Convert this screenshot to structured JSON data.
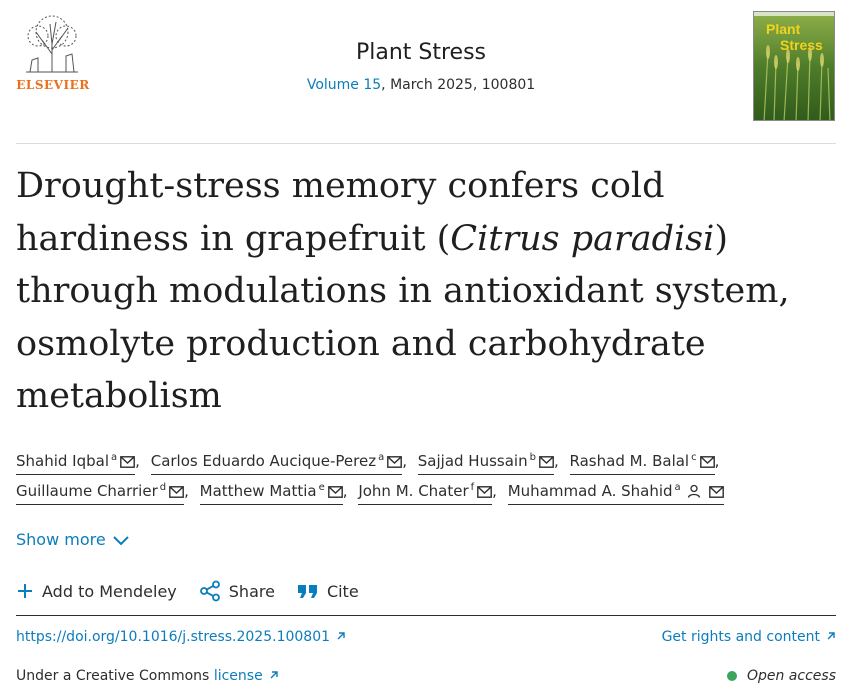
{
  "header": {
    "publisher": "ELSEVIER",
    "journal_title": "Plant Stress",
    "volume_link": "Volume 15",
    "issue_info": ", March 2025, 100801"
  },
  "cover": {
    "title_line1": "Plant",
    "title_line2": "Stress",
    "title_color": "#f2d21b"
  },
  "article": {
    "title_part1": "Drought-stress memory confers cold hardiness in grapefruit (",
    "title_italic": "Citrus paradisi",
    "title_part2": ") through modulations in antioxidant system, osmolyte production and carbohydrate metabolism"
  },
  "authors": [
    {
      "name": "Shahid Iqbal",
      "sup": "a"
    },
    {
      "name": "Carlos Eduardo Aucique-Perez",
      "sup": "a"
    },
    {
      "name": "Sajjad Hussain",
      "sup": "b"
    },
    {
      "name": "Rashad M. Balal",
      "sup": "c"
    },
    {
      "name": "Guillaume Charrier",
      "sup": "d"
    },
    {
      "name": "Matthew Mattia",
      "sup": "e"
    },
    {
      "name": "John M. Chater",
      "sup": "f"
    },
    {
      "name": "Muhammad A. Shahid",
      "sup": "a"
    }
  ],
  "show_more": "Show more",
  "actions": {
    "mendeley": "Add to Mendeley",
    "share": "Share",
    "cite": "Cite"
  },
  "doi": "https://doi.org/10.1016/j.stress.2025.100801",
  "rights": "Get rights and content",
  "license": {
    "prefix": "Under a Creative Commons ",
    "link": "license"
  },
  "open_access": "Open access",
  "colors": {
    "link": "#0c7dbb",
    "elsevier_orange": "#e9711c",
    "open_access_dot": "#3ba55c"
  }
}
